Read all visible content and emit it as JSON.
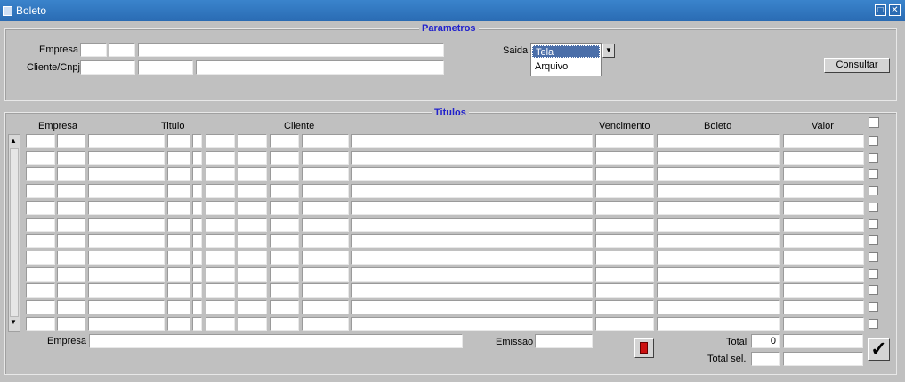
{
  "window": {
    "title": "Boleto"
  },
  "parametros": {
    "title": "Parametros",
    "empresa_label": "Empresa",
    "cliente_label": "Cliente/Cnpj",
    "saida_label": "Saida",
    "saida_options": [
      "Tela",
      "Arquivo"
    ],
    "saida_selected": "Tela",
    "consultar_label": "Consultar"
  },
  "titulos": {
    "title": "Titulos",
    "columns": {
      "empresa": "Empresa",
      "titulo": "Titulo",
      "cliente": "Cliente",
      "vencimento": "Vencimento",
      "boleto": "Boleto",
      "valor": "Valor"
    },
    "row_count": 12
  },
  "footer": {
    "empresa_label": "Empresa",
    "emissao_label": "Emissao",
    "total_label": "Total",
    "total_value": "0",
    "total_sel_label": "Total sel."
  },
  "icons": {
    "exit": "exit-door-icon",
    "confirm": "checkmark-icon"
  }
}
